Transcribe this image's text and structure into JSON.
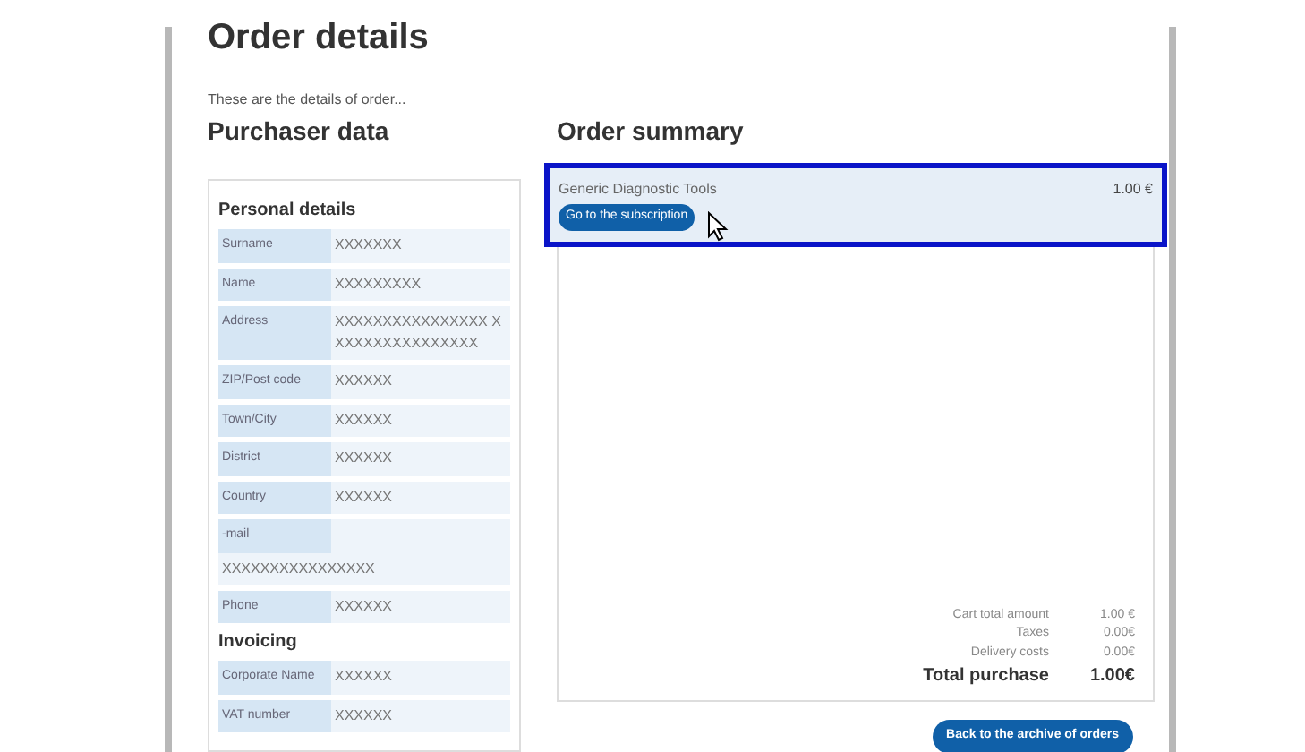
{
  "page": {
    "title": "Order details",
    "intro": "These are the details of order..."
  },
  "purchaser": {
    "heading": "Purchaser data",
    "sections": [
      {
        "heading": "Personal details",
        "rows": [
          {
            "label": "Surname",
            "value": "XXXXXXX"
          },
          {
            "label": "Name",
            "value": "XXXXXXXXX"
          },
          {
            "label": "Address",
            "value": "XXXXXXXXXXXXXXXX XXXXXXXXXXXXXXXX"
          },
          {
            "label": "ZIP/Post code",
            "value": "XXXXXX"
          },
          {
            "label": "Town/City",
            "value": "XXXXXX"
          },
          {
            "label": "District",
            "value": "XXXXXX"
          },
          {
            "label": "Country",
            "value": "XXXXXX"
          },
          {
            "label": "-mail",
            "value": "XXXXXXXXXXXXXXXX",
            "wrap": true
          },
          {
            "label": "Phone",
            "value": "XXXXXX"
          }
        ]
      },
      {
        "heading": "Invoicing",
        "rows": [
          {
            "label": "Corporate Name",
            "value": "XXXXXX"
          },
          {
            "label": "VAT number",
            "value": "XXXXXX"
          }
        ]
      }
    ]
  },
  "summary": {
    "heading": "Order summary",
    "items": [
      {
        "name": "Generic Diagnostic Tools",
        "price": "1.00 €",
        "button": "Go to the subscription",
        "highlighted": true
      }
    ],
    "totals": [
      {
        "label": "Cart total amount",
        "value": "1.00 €",
        "kind": "line"
      },
      {
        "label": "Taxes",
        "value": "0.00€",
        "kind": "line"
      },
      {
        "label": "Delivery costs",
        "value": "0.00€",
        "kind": "line"
      },
      {
        "label": "Total purchase",
        "value": "1.00€",
        "kind": "total"
      }
    ],
    "back_button": "Back to the archive of orders"
  }
}
